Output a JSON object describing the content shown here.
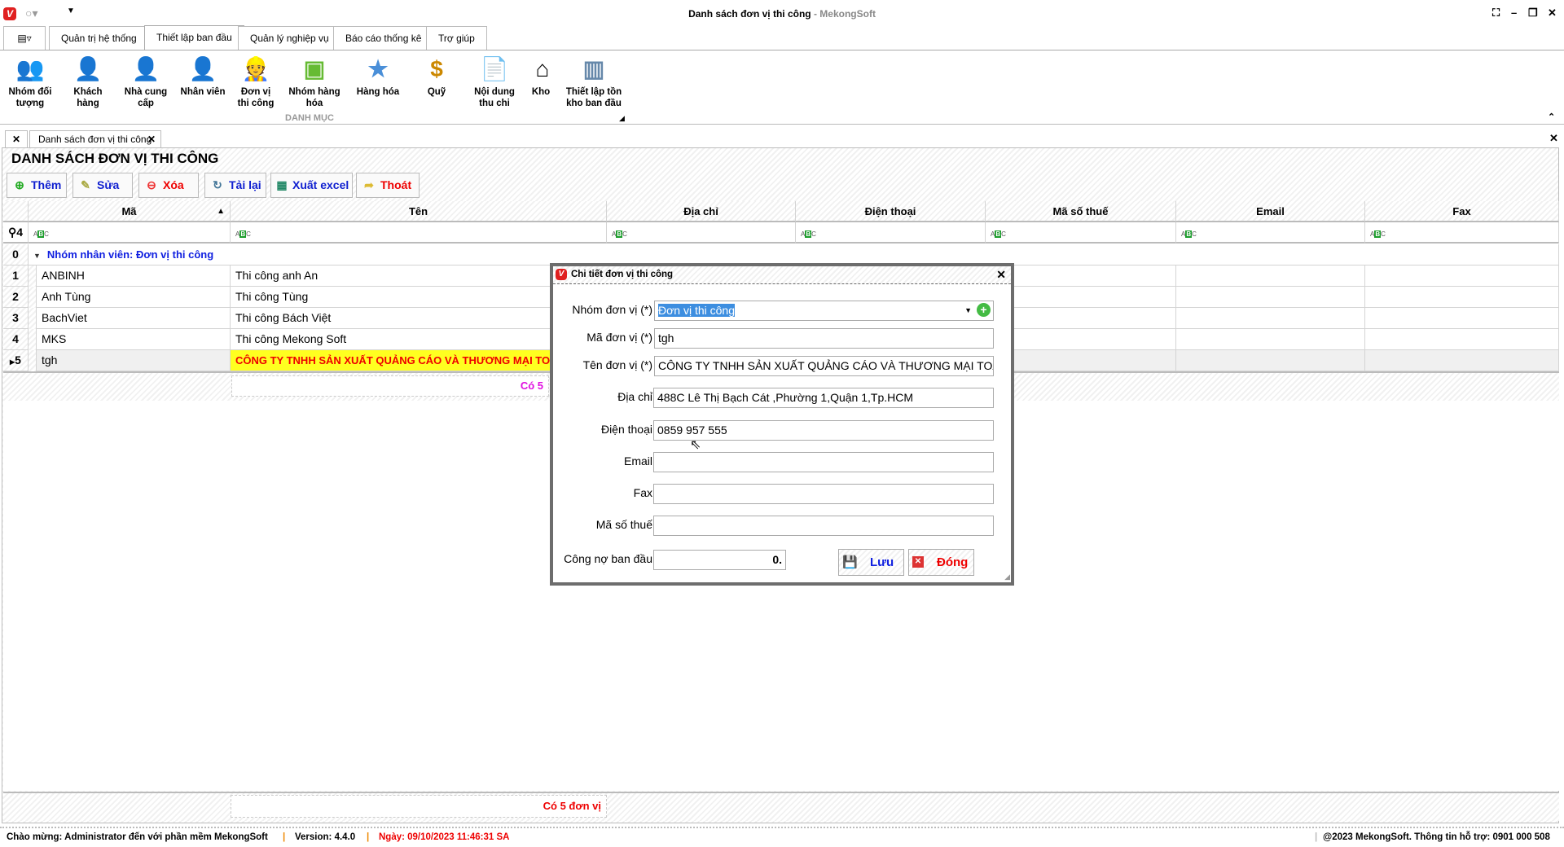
{
  "window": {
    "title": "Danh sách đơn vị thi công",
    "brand": " - MekongSoft"
  },
  "ribbon": {
    "tabs": [
      "Quản trị hệ thống",
      "Thiết lập ban đầu",
      "Quản lý nghiệp vụ",
      "Báo cáo thống kê",
      "Trợ giúp"
    ],
    "active_tab": 1,
    "buttons": [
      {
        "label": "Nhóm đối tượng",
        "icon": "people-group-icon"
      },
      {
        "label": "Khách hàng",
        "icon": "customer-icon"
      },
      {
        "label": "Nhà cung cấp",
        "icon": "supplier-icon"
      },
      {
        "label": "Nhân viên",
        "icon": "employee-icon"
      },
      {
        "label": "Đơn vị thi công",
        "icon": "worker-icon"
      },
      {
        "label": "Nhóm hàng hóa",
        "icon": "product-group-icon"
      },
      {
        "label": "Hàng hóa",
        "icon": "star-icon"
      },
      {
        "label": "Quỹ",
        "icon": "coins-icon"
      },
      {
        "label": "Nội dung thu chi",
        "icon": "document-add-icon"
      },
      {
        "label": "Kho",
        "icon": "house-icon"
      },
      {
        "label": "Thiết lập tồn kho ban đầu",
        "icon": "columns-icon"
      }
    ],
    "group_label": "DANH MỤC"
  },
  "doc_tab": "Danh sách đơn vị thi công",
  "panel": {
    "title": "DANH SÁCH ĐƠN VỊ THI CÔNG"
  },
  "toolbar": {
    "add": "Thêm",
    "edit": "Sửa",
    "delete": "Xóa",
    "reload": "Tải lại",
    "export": "Xuất excel",
    "exit": "Thoát"
  },
  "grid": {
    "columns": [
      "Mã",
      "Tên",
      "Địa chỉ",
      "Điện thoại",
      "Mã số thuế",
      "Email",
      "Fax"
    ],
    "filter_indicator": "4",
    "group_index": "0",
    "group_label": "Nhóm nhân viên: Đơn vị thi công",
    "rows": [
      {
        "idx": "1",
        "ma": "ANBINH",
        "ten": "Thi công anh An"
      },
      {
        "idx": "2",
        "ma": "Anh Tùng",
        "ten": "Thi công Tùng"
      },
      {
        "idx": "3",
        "ma": "BachViet",
        "ten": "Thi công Bách Việt"
      },
      {
        "idx": "4",
        "ma": "MKS",
        "ten": "Thi công Mekong Soft"
      },
      {
        "idx": "5",
        "ma": "tgh",
        "ten": "CÔNG TY TNHH SẢN XUẤT QUẢNG CÁO VÀ THƯƠNG MẠI TOÀN GIA"
      }
    ],
    "group_summary": "Có 5",
    "footer_summary": "Có 5 đơn vị"
  },
  "dialog": {
    "title": "Chi tiết đơn vị thi công",
    "fields": {
      "nhom": {
        "label": "Nhóm đơn vị (*)",
        "value": "Đơn vị thi công"
      },
      "ma": {
        "label": "Mã đơn vị (*)",
        "value": "tgh"
      },
      "ten": {
        "label": "Tên đơn vị (*)",
        "value": "CÔNG TY TNHH SẢN XUẤT QUẢNG CÁO VÀ THƯƠNG MẠI TOÀN GIA"
      },
      "diachi": {
        "label": "Địa chỉ",
        "value": "488C Lê Thị Bạch Cát ,Phường 1,Quận 1,Tp.HCM"
      },
      "dienthoai": {
        "label": "Điện thoại",
        "value": "0859 957 555"
      },
      "email": {
        "label": "Email",
        "value": ""
      },
      "fax": {
        "label": "Fax",
        "value": ""
      },
      "mst": {
        "label": "Mã số thuế",
        "value": ""
      },
      "congno": {
        "label": "Công nợ ban đầu",
        "value": "0."
      }
    },
    "save": "Lưu",
    "close": "Đóng"
  },
  "status": {
    "welcome": "Chào mừng: Administrator đến với phần mềm MekongSoft",
    "version": "Version: 4.4.0",
    "date": "Ngày: 09/10/2023 11:46:31 SA",
    "copyright": "@2023 MekongSoft. Thông tin hỗ trợ: 0901 000 508"
  }
}
